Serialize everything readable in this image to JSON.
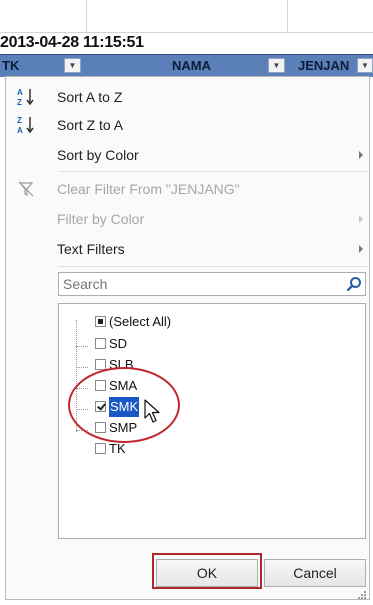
{
  "sheet": {
    "timestamp": "2013-04-28 11:15:51",
    "headers": [
      {
        "label": "TK"
      },
      {
        "label": "NAMA"
      },
      {
        "label": "JENJAN"
      }
    ]
  },
  "menu": {
    "sort_az": "Sort A to Z",
    "sort_za": "Sort Z to A",
    "sort_color": "Sort by Color",
    "clear_filter": "Clear Filter From \"JENJANG\"",
    "filter_color": "Filter by Color",
    "text_filters": "Text Filters",
    "search_placeholder": "Search",
    "items": [
      {
        "label": "(Select All)",
        "state": "partial"
      },
      {
        "label": "SD",
        "state": "unchecked"
      },
      {
        "label": "SLB",
        "state": "unchecked"
      },
      {
        "label": "SMA",
        "state": "unchecked"
      },
      {
        "label": "SMK",
        "state": "checked"
      },
      {
        "label": "SMP",
        "state": "unchecked"
      },
      {
        "label": "TK",
        "state": "unchecked"
      }
    ],
    "ok_label": "OK",
    "cancel_label": "Cancel"
  },
  "colors": {
    "header_fill": "#5b7fb8",
    "selection": "#1c57c8",
    "annotation_red": "#c0282e"
  }
}
